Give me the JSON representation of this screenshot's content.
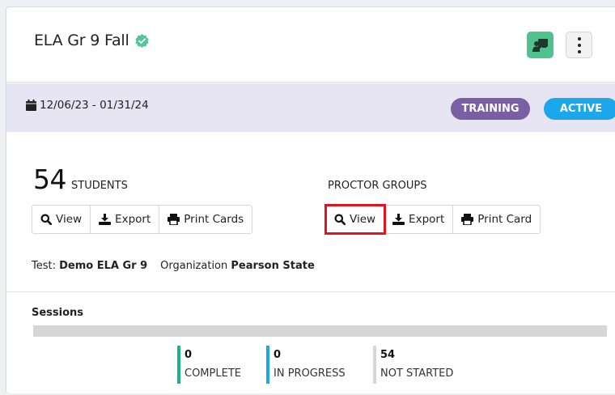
{
  "header": {
    "title": "ELA Gr 9 Fall",
    "title_icon": "verified-badge-icon",
    "teacher_icon": "teacher-board-icon",
    "more_icon": "kebab-menu-icon"
  },
  "band": {
    "date_range": "12/06/23 - 01/31/24",
    "badges": [
      "TRAINING",
      "ACTIVE"
    ]
  },
  "students": {
    "count": "54",
    "label": "STUDENTS",
    "buttons": [
      "View",
      "Export",
      "Print Cards"
    ]
  },
  "proctor_groups": {
    "label": "PROCTOR GROUPS",
    "buttons": [
      "View",
      "Export",
      "Print Card"
    ],
    "highlighted": "View"
  },
  "meta": {
    "test_label": "Test:",
    "test_value": "Demo ELA Gr 9",
    "org_label": "Organization",
    "org_value": "Pearson State"
  },
  "sessions": {
    "label": "Sessions",
    "stats": [
      {
        "value": "0",
        "label": "COMPLETE",
        "color": "#1ab584"
      },
      {
        "value": "0",
        "label": "IN PROGRESS",
        "color": "#1aa7ec"
      },
      {
        "value": "54",
        "label": "NOT STARTED",
        "color": "#d6d6d6"
      }
    ]
  },
  "colors": {
    "band": "#e7e4f3",
    "training": "#7a5fa4",
    "active": "#1aa7ec",
    "highlight": "#e0141c",
    "teacher_button": "#4fc28e"
  }
}
